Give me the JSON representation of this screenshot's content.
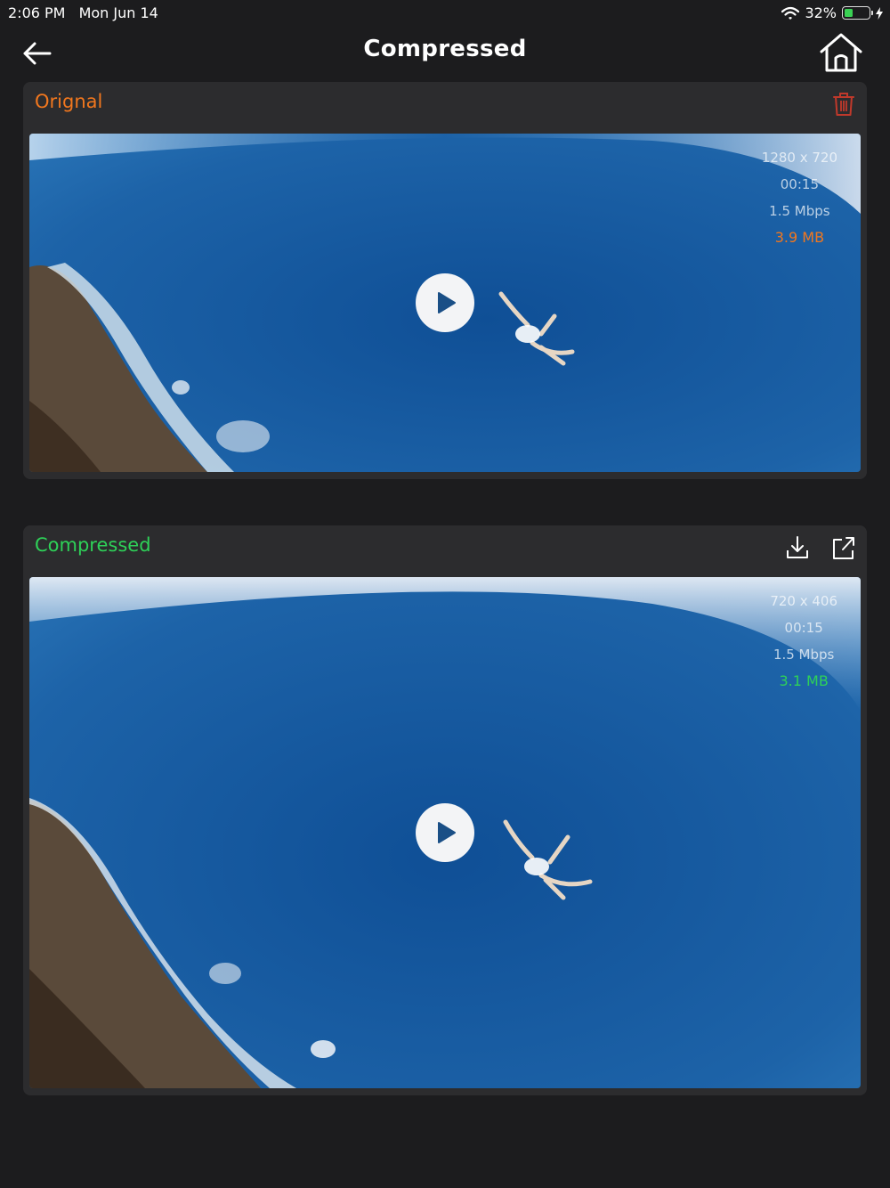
{
  "status_bar": {
    "time": "2:06 PM",
    "date": "Mon Jun 14",
    "battery_percent": "32%",
    "wifi_icon": "wifi-icon",
    "charging_icon": "bolt-icon"
  },
  "nav": {
    "title": "Compressed",
    "back_icon": "arrow-left-icon",
    "home_icon": "home-icon"
  },
  "original": {
    "label": "Orignal",
    "label_color": "#f1771e",
    "delete_icon": "trash-icon",
    "resolution": "1280 x 720",
    "duration": "00:15",
    "bitrate": "1.5 Mbps",
    "size": "3.9 MB"
  },
  "compressed": {
    "label": "Compressed",
    "label_color": "#2ed158",
    "download_icon": "download-icon",
    "share_icon": "share-icon",
    "resolution": "720 x 406",
    "duration": "00:15",
    "bitrate": "1.5 Mbps",
    "size": "3.1 MB"
  },
  "colors": {
    "background": "#1c1c1e",
    "panel": "#2c2c2e",
    "accent_orange": "#f1771e",
    "accent_green": "#2ed158"
  }
}
